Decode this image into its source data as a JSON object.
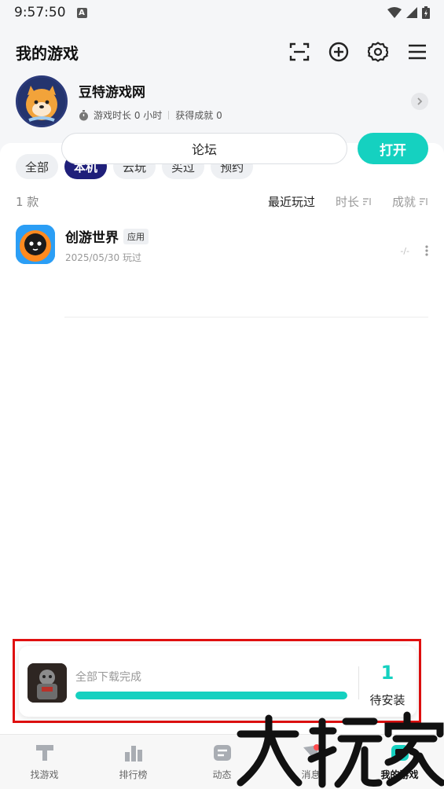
{
  "status_bar": {
    "time": "9:57:50",
    "a_badge": "A"
  },
  "header": {
    "title": "我的游戏",
    "icons": [
      "scan-icon",
      "add-circle-icon",
      "settings-icon",
      "menu-icon"
    ]
  },
  "profile": {
    "name": "豆特游戏网",
    "play_time": "游戏时长 0 小时",
    "achievements": "获得成就 0"
  },
  "tabs": [
    {
      "label": "全部",
      "active": false
    },
    {
      "label": "本机",
      "active": true
    },
    {
      "label": "云玩",
      "active": false
    },
    {
      "label": "买过",
      "active": false
    },
    {
      "label": "预约",
      "active": false
    }
  ],
  "sort": {
    "count": "1 款",
    "options": [
      {
        "label": "最近玩过",
        "active": true
      },
      {
        "label": "时长",
        "active": false
      },
      {
        "label": "成就",
        "active": false
      }
    ]
  },
  "games": [
    {
      "name": "创游世界",
      "tag": "应用",
      "last_played": "2025/05/30 玩过",
      "progress": "-/-",
      "forum_label": "论坛",
      "open_label": "打开"
    }
  ],
  "download_panel": {
    "status": "全部下载完成",
    "progress_percent": 100,
    "pending_count": "1",
    "pending_label": "待安装"
  },
  "bottom_nav": [
    {
      "label": "找游戏",
      "icon": "find-games-icon",
      "active": false
    },
    {
      "label": "排行榜",
      "icon": "ranking-icon",
      "active": false
    },
    {
      "label": "动态",
      "icon": "feed-icon",
      "active": false
    },
    {
      "label": "消息",
      "icon": "message-icon",
      "active": false
    },
    {
      "label": "我的游戏",
      "icon": "my-games-icon",
      "active": true
    }
  ],
  "watermark": "大玩家",
  "colors": {
    "accent": "#15d1c0",
    "tab_active": "#1f1f7a",
    "highlight_box": "#e01010"
  }
}
